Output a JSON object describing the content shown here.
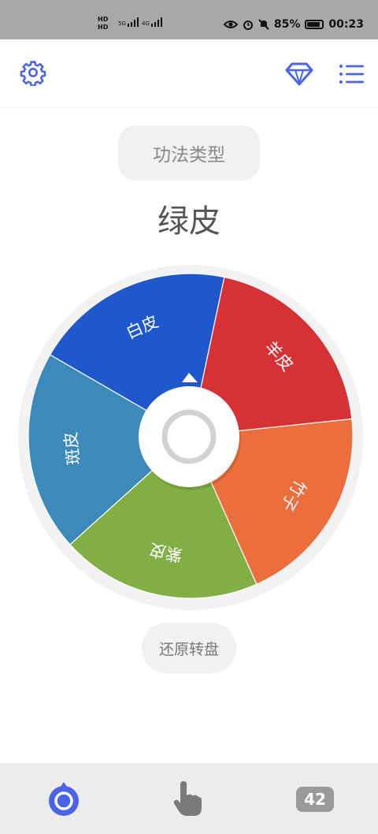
{
  "status_bar": {
    "hd_top": "HD",
    "hd_bottom": "HD",
    "signal_1": "5G",
    "signal_2": "4G",
    "battery": "85%",
    "time": "00:23"
  },
  "header": {
    "settings_icon": "gear-icon",
    "premium_icon": "diamond-icon",
    "menu_icon": "list-icon",
    "accent_color": "#4a63e8"
  },
  "category": {
    "label": "功法类型"
  },
  "result": {
    "text": "绿皮"
  },
  "wheel": {
    "segments": [
      {
        "label": "羊皮",
        "color": "#d63235"
      },
      {
        "label": "竹子",
        "color": "#eb6e3c"
      },
      {
        "label": "紫皮",
        "color": "#82ae46"
      },
      {
        "label": "斑皮",
        "color": "#3c8aba"
      },
      {
        "label": "白皮",
        "color": "#1e58cc"
      }
    ],
    "pointer_icon": "pointer-icon"
  },
  "restore_button": {
    "label": "还原转盘"
  },
  "bottom_nav": {
    "items": [
      {
        "icon": "wheel-icon",
        "active": true
      },
      {
        "icon": "hand-pointer-icon",
        "active": false
      },
      {
        "icon": "counter-badge",
        "label": "42",
        "active": false
      }
    ]
  }
}
